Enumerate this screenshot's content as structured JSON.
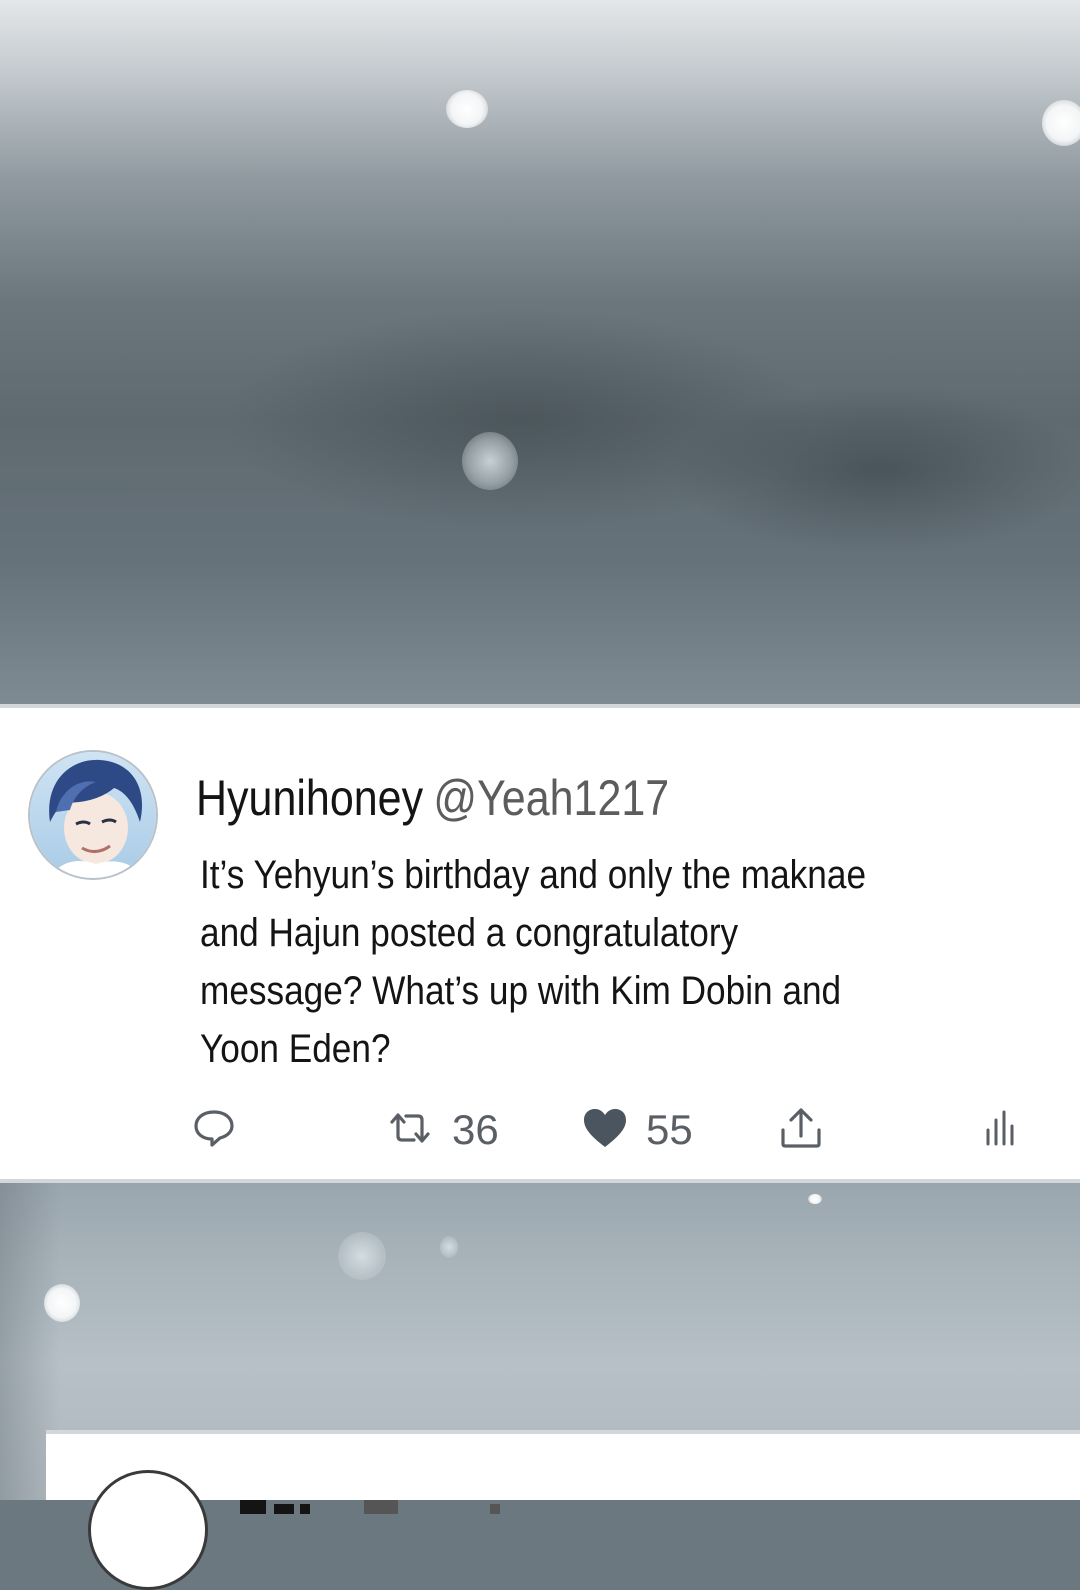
{
  "tweet": {
    "display_name": "Hyunihoney",
    "handle": "@Yeah1217",
    "text_lines": [
      "It’s Yehyun’s birthday and only the maknae",
      "and Hajun posted a congratulatory",
      "message? What’s up with Kim Dobin and",
      "Yoon Eden?"
    ],
    "actions": {
      "reply_icon": "reply-bubble-icon",
      "retweet_icon": "retweet-icon",
      "retweet_count": "36",
      "like_icon": "heart-icon",
      "like_count": "55",
      "share_icon": "share-icon",
      "analytics_icon": "analytics-icon"
    }
  },
  "colors": {
    "icon_gray": "#5a5f66",
    "heart_fill": "#4a5560",
    "card_bg": "#ffffff"
  }
}
